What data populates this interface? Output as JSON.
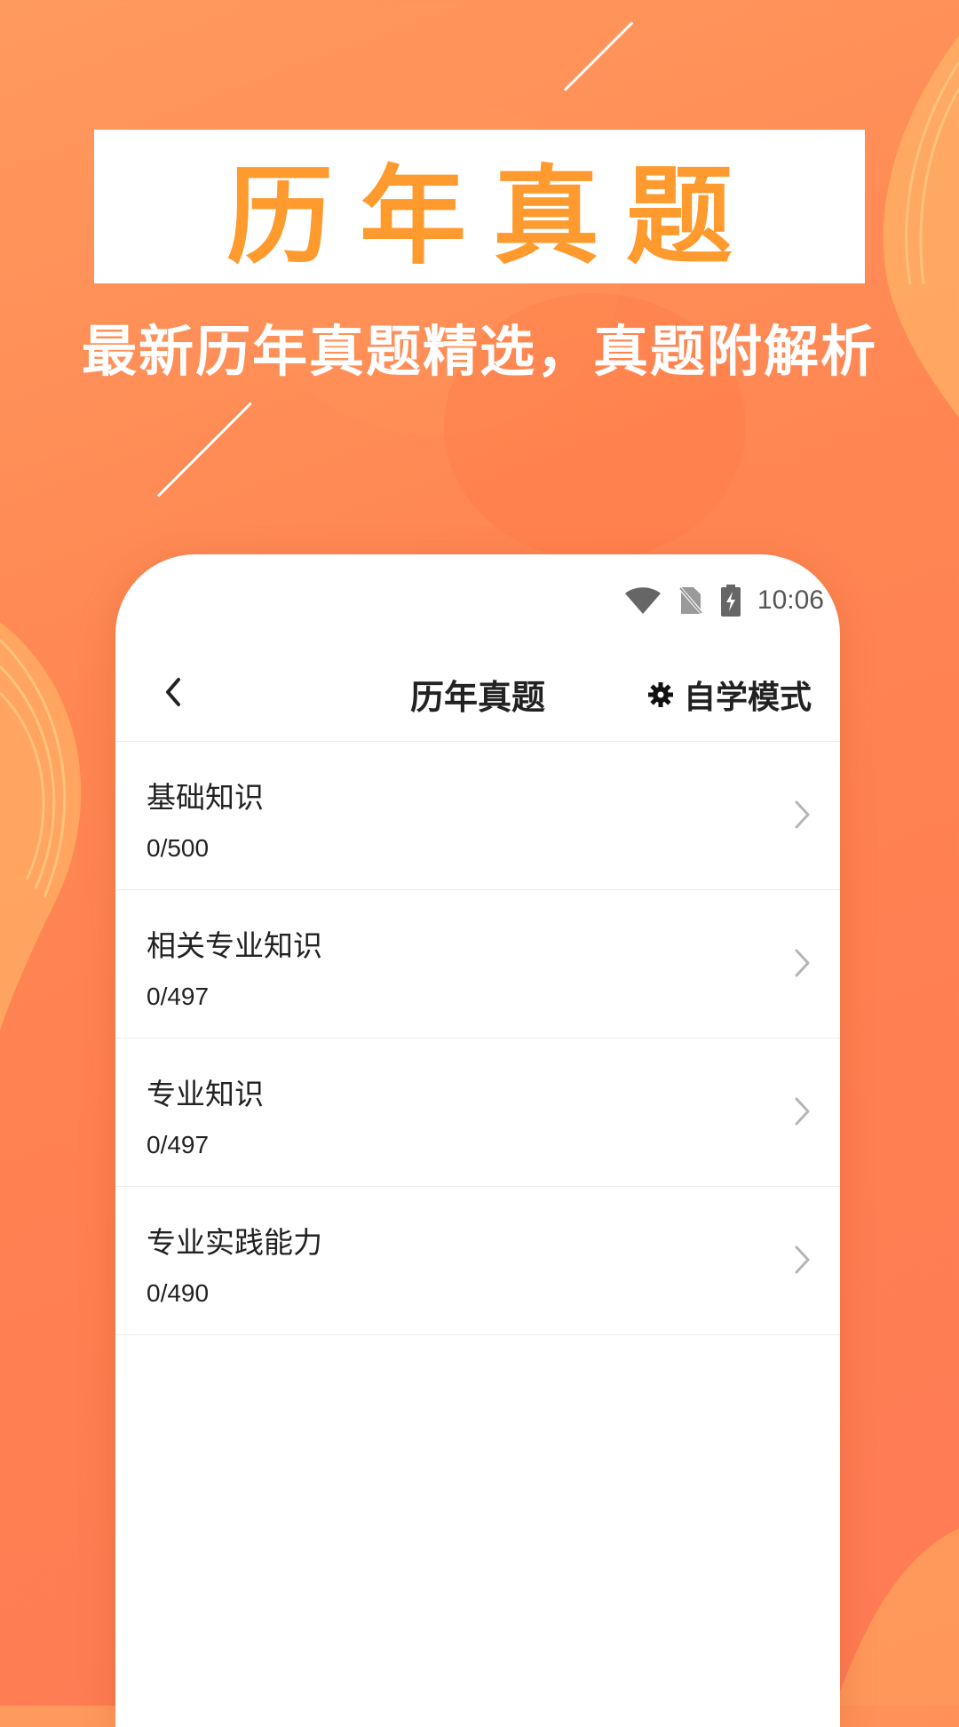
{
  "promo": {
    "headline": "历年真题",
    "subtitle": "最新历年真题精选，真题附解析"
  },
  "status_bar": {
    "time": "10:06",
    "icons": [
      "wifi-icon",
      "no-sim-icon",
      "battery-charging-icon"
    ]
  },
  "nav": {
    "title": "历年真题",
    "mode_label": "自学模式",
    "back_icon": "chevron-left-icon",
    "mode_icon": "gear-icon"
  },
  "list": {
    "items": [
      {
        "title": "基础知识",
        "count": "0/500"
      },
      {
        "title": "相关专业知识",
        "count": "0/497"
      },
      {
        "title": "专业知识",
        "count": "0/497"
      },
      {
        "title": "专业实践能力",
        "count": "0/490"
      }
    ]
  },
  "colors": {
    "background": "#ff8753",
    "headline_accent": "#ff9a2e",
    "card": "#ffffff"
  }
}
